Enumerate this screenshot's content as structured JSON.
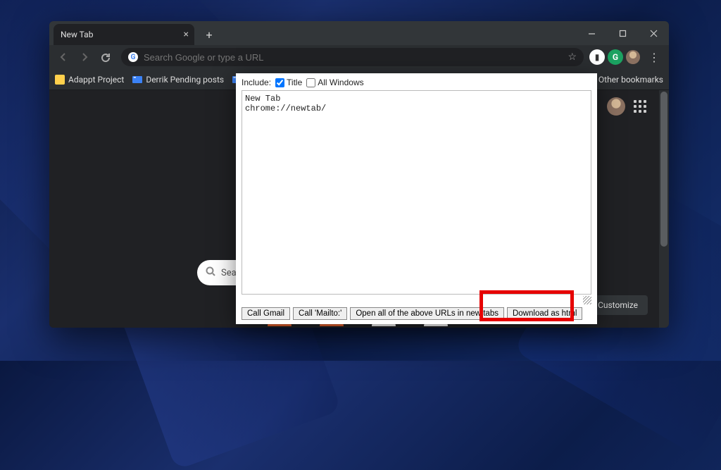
{
  "tab": {
    "title": "New Tab"
  },
  "omnibox": {
    "placeholder": "Search Google or type a URL"
  },
  "bookmarks": {
    "items": [
      {
        "label": "Adappt Project"
      },
      {
        "label": "Derrik Pending posts"
      }
    ],
    "other_label": "Other bookmarks"
  },
  "newtab": {
    "search_hint": "Sea",
    "customize_label": "Customize"
  },
  "popup": {
    "include_label": "Include:",
    "title_label": "Title",
    "allwin_label": "All Windows",
    "title_checked": true,
    "allwin_checked": false,
    "textarea_value": "New Tab\nchrome://newtab/",
    "buttons": {
      "call_gmail": "Call Gmail",
      "call_mailto": "Call 'Mailto:'",
      "open_all": "Open all of the above URLs in new tabs",
      "download_html": "Download as html"
    }
  }
}
